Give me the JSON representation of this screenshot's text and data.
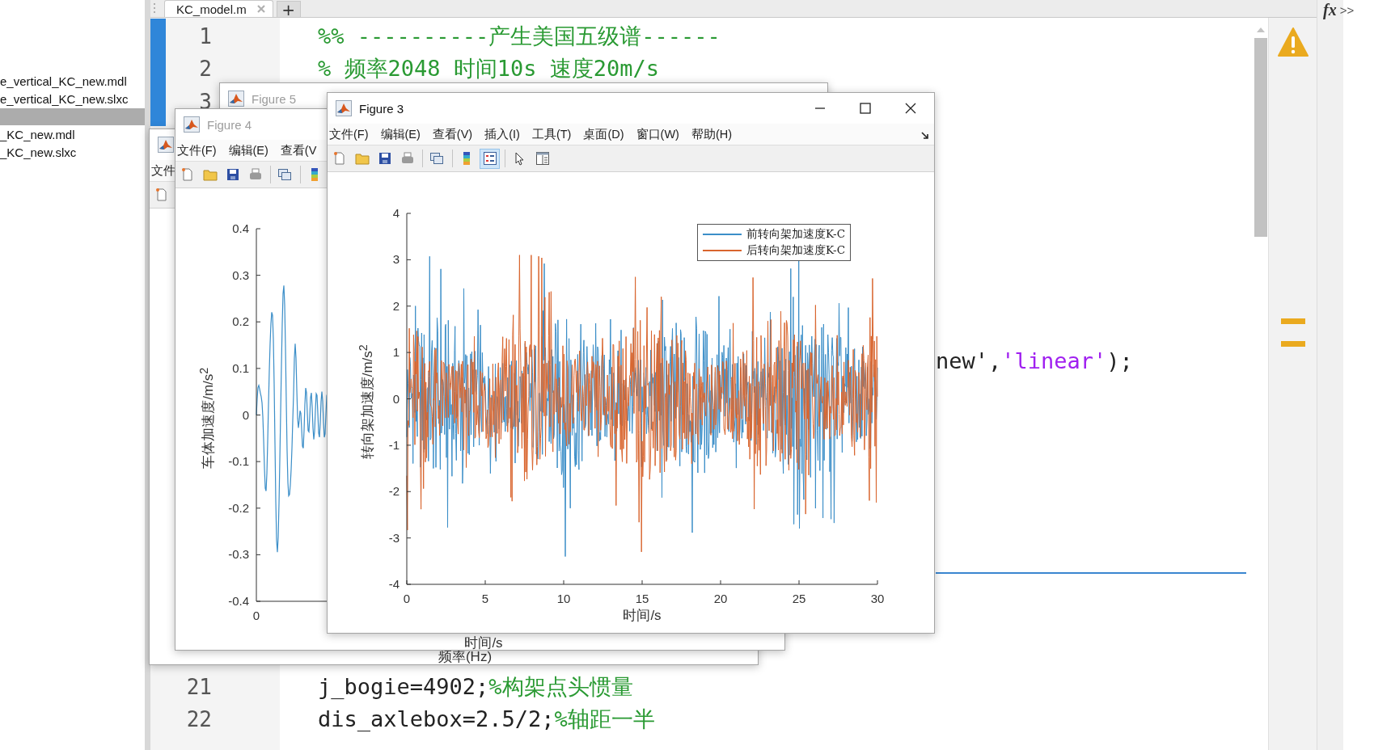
{
  "file_browser": {
    "items": [
      {
        "name": "e_vertical_KC_new.mdl",
        "selected": false
      },
      {
        "name": "e_vertical_KC_new.slxc",
        "selected": false
      },
      {
        "selected": true
      },
      {
        "name": "_KC_new.mdl",
        "selected": false
      },
      {
        "name": "_KC_new.slxc",
        "selected": false
      }
    ]
  },
  "editor": {
    "tab": {
      "title": "KC_model.m"
    },
    "new_tab": "+",
    "top_lines": [
      {
        "number": "1",
        "segments": [
          {
            "kind": "comment",
            "text": "%% ----------产生美国五级谱------"
          }
        ]
      },
      {
        "number": "2",
        "segments": [
          {
            "kind": "comment",
            "text": "% 频率2048 时间10s 速度20m/s"
          }
        ]
      },
      {
        "number": "3"
      }
    ],
    "fragment": {
      "segments": [
        {
          "kind": "code",
          "text": "new',"
        },
        {
          "kind": "string",
          "text": "'linear'"
        },
        {
          "kind": "code",
          "text": ");"
        }
      ]
    },
    "bottom_lines": [
      {
        "number": "21",
        "segments": [
          {
            "kind": "code",
            "text": "j_bogie=4902;"
          },
          {
            "kind": "comment",
            "text": "%构架点头惯量"
          }
        ]
      },
      {
        "number": "22",
        "segments": [
          {
            "kind": "code",
            "text": "dis_axlebox=2.5/2;"
          },
          {
            "kind": "comment",
            "text": "%轴距一半"
          }
        ]
      }
    ]
  },
  "command_hint": {
    "symbol": "fx",
    "more": ">>"
  },
  "figures": [
    {
      "menu": [
        "文件"
      ],
      "toolbar": [
        {
          "kind": "new",
          "selected": false,
          "separator_before": false
        }
      ],
      "axes": {
        "kind": "label_only",
        "xlabel": "频率(Hz)"
      }
    },
    {
      "title": "Figure 5",
      "active": false
    },
    {
      "title": "Figure 4",
      "active": false,
      "menu": [
        "文件(F)",
        "编辑(E)",
        "查看(V"
      ],
      "toolbar": [
        {
          "kind": "new",
          "selected": false,
          "separator_before": false
        },
        {
          "kind": "open",
          "selected": false,
          "separator_before": false
        },
        {
          "kind": "save",
          "selected": false,
          "separator_before": false
        },
        {
          "kind": "print",
          "selected": false,
          "separator_before": false
        },
        {
          "kind": "link",
          "selected": false,
          "separator_before": true
        },
        {
          "kind": "colorbar",
          "selected": false,
          "separator_before": true
        }
      ],
      "axes": {
        "kind": "damped",
        "yticks": [
          "0.4",
          "0.3",
          "0.2",
          "0.1",
          "0",
          "-0.1",
          "-0.2",
          "-0.3",
          "-0.4"
        ],
        "xticks": [
          "0"
        ],
        "xlabel": "时间/s",
        "ylabel": "车体加速度/m/s$^{2}$"
      }
    },
    {
      "title": "Figure 3",
      "active": true,
      "window_controls": true,
      "dock_arrow": true,
      "menu": [
        "文件(F)",
        "编辑(E)",
        "查看(V)",
        "插入(I)",
        "工具(T)",
        "桌面(D)",
        "窗口(W)",
        "帮助(H)"
      ],
      "toolbar": [
        {
          "kind": "new",
          "selected": false,
          "separator_before": false
        },
        {
          "kind": "open",
          "selected": false,
          "separator_before": false
        },
        {
          "kind": "save",
          "selected": false,
          "separator_before": false
        },
        {
          "kind": "print",
          "selected": false,
          "separator_before": false
        },
        {
          "kind": "link",
          "selected": false,
          "separator_before": true
        },
        {
          "kind": "colorbar",
          "selected": false,
          "separator_before": true
        },
        {
          "kind": "legend",
          "selected": true,
          "separator_before": false
        },
        {
          "kind": "pointer",
          "selected": false,
          "separator_before": true
        },
        {
          "kind": "inspector",
          "selected": false,
          "separator_before": false
        }
      ],
      "axes": {
        "kind": "noise",
        "yticks": [
          "4",
          "3",
          "2",
          "1",
          "0",
          "-1",
          "-2",
          "-3",
          "-4"
        ],
        "xticks": [
          "0",
          "5",
          "10",
          "15",
          "20",
          "25",
          "30"
        ],
        "xlabel": "时间/s",
        "ylabel": "转向架加速度/m/s$^{2}$",
        "series": [
          {
            "label": "前转向架加速度K-C",
            "color": "#3b8ec8"
          },
          {
            "label": "后转向架加速度K-C",
            "color": "#d9652e"
          }
        ]
      }
    }
  ]
}
